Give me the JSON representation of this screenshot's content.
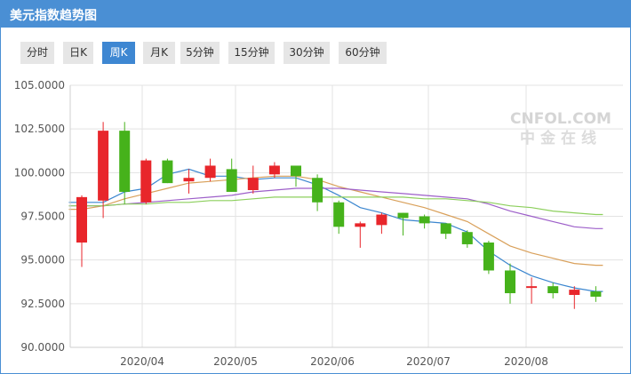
{
  "header": {
    "title": "美元指数趋势图"
  },
  "tabs": [
    {
      "label": "分时",
      "active": false
    },
    {
      "label": "日K",
      "active": false
    },
    {
      "label": "周K",
      "active": true
    },
    {
      "label": "月K",
      "active": false
    },
    {
      "label": "5分钟",
      "active": false
    },
    {
      "label": "15分钟",
      "active": false
    },
    {
      "label": "30分钟",
      "active": false
    },
    {
      "label": "60分钟",
      "active": false
    }
  ],
  "watermark": {
    "brand": "CNFOL.COM",
    "cn": "中金在线"
  },
  "colors": {
    "accent": "#4a8fd4",
    "active_tab": "#3e87d2",
    "up": "#e8262b",
    "down": "#46b21b",
    "ma5": "#3b86cf",
    "ma10": "#d9a05a",
    "ma20": "#9d5fc9",
    "ma30": "#8ccf5c"
  },
  "chart_data": {
    "type": "candlestick",
    "title": "",
    "xlabel": "",
    "ylabel": "",
    "ylim": [
      90,
      105
    ],
    "yticks": [
      "105.0000",
      "102.5000",
      "100.0000",
      "97.5000",
      "95.0000",
      "92.5000",
      "90.0000"
    ],
    "xticks": [
      "2020/04",
      "2020/05",
      "2020/06",
      "2020/07",
      "2020/08"
    ],
    "grid": true,
    "candles": [
      {
        "open": 96.0,
        "close": 98.6,
        "high": 98.7,
        "low": 94.6
      },
      {
        "open": 98.4,
        "close": 102.4,
        "high": 102.9,
        "low": 97.4
      },
      {
        "open": 102.4,
        "close": 98.9,
        "high": 102.9,
        "low": 98.2
      },
      {
        "open": 98.3,
        "close": 100.7,
        "high": 100.8,
        "low": 98.2
      },
      {
        "open": 100.7,
        "close": 99.4,
        "high": 100.8,
        "low": 99.4
      },
      {
        "open": 99.5,
        "close": 99.7,
        "high": 100.2,
        "low": 98.8
      },
      {
        "open": 99.7,
        "close": 100.4,
        "high": 100.8,
        "low": 99.5
      },
      {
        "open": 100.2,
        "close": 98.9,
        "high": 100.8,
        "low": 98.9
      },
      {
        "open": 99.0,
        "close": 99.7,
        "high": 100.4,
        "low": 98.8
      },
      {
        "open": 99.9,
        "close": 100.4,
        "high": 100.6,
        "low": 99.7
      },
      {
        "open": 100.4,
        "close": 99.8,
        "high": 100.4,
        "low": 99.2
      },
      {
        "open": 99.7,
        "close": 98.3,
        "high": 99.9,
        "low": 97.8
      },
      {
        "open": 98.3,
        "close": 96.9,
        "high": 98.4,
        "low": 96.5
      },
      {
        "open": 96.9,
        "close": 97.1,
        "high": 97.2,
        "low": 95.7
      },
      {
        "open": 97.0,
        "close": 97.6,
        "high": 97.7,
        "low": 96.5
      },
      {
        "open": 97.7,
        "close": 97.4,
        "high": 97.7,
        "low": 96.4
      },
      {
        "open": 97.5,
        "close": 97.1,
        "high": 97.6,
        "low": 96.8
      },
      {
        "open": 97.1,
        "close": 96.5,
        "high": 97.1,
        "low": 96.2
      },
      {
        "open": 96.6,
        "close": 95.9,
        "high": 96.7,
        "low": 95.7
      },
      {
        "open": 96.0,
        "close": 94.4,
        "high": 96.1,
        "low": 94.2
      },
      {
        "open": 94.4,
        "close": 93.1,
        "high": 94.8,
        "low": 92.5
      },
      {
        "open": 93.4,
        "close": 93.5,
        "high": 94.0,
        "low": 92.5
      },
      {
        "open": 93.5,
        "close": 93.1,
        "high": 93.7,
        "low": 92.8
      },
      {
        "open": 93.0,
        "close": 93.3,
        "high": 93.5,
        "low": 92.2
      },
      {
        "open": 93.2,
        "close": 92.9,
        "high": 93.5,
        "low": 92.6
      }
    ],
    "moving_averages": [
      {
        "values": [
          98.3,
          98.3,
          98.9,
          99.1,
          99.9,
          100.2,
          99.8,
          99.8,
          99.6,
          99.7,
          99.7,
          99.3,
          98.7,
          98.0,
          97.7,
          97.3,
          97.2,
          97.1,
          96.6,
          95.5,
          94.7,
          94.1,
          93.7,
          93.4,
          93.2
        ]
      },
      {
        "values": [
          97.9,
          98.1,
          98.5,
          98.8,
          99.1,
          99.4,
          99.5,
          99.6,
          99.7,
          99.8,
          99.8,
          99.6,
          99.2,
          98.9,
          98.6,
          98.3,
          98.0,
          97.6,
          97.2,
          96.5,
          95.8,
          95.4,
          95.1,
          94.8,
          94.7
        ]
      },
      {
        "values": [
          98.1,
          98.1,
          98.2,
          98.3,
          98.4,
          98.5,
          98.6,
          98.7,
          98.9,
          99.0,
          99.1,
          99.1,
          99.1,
          99.0,
          98.9,
          98.8,
          98.7,
          98.6,
          98.5,
          98.2,
          97.8,
          97.5,
          97.2,
          96.9,
          96.8
        ]
      },
      {
        "values": [
          98.1,
          98.1,
          98.2,
          98.2,
          98.3,
          98.3,
          98.4,
          98.4,
          98.5,
          98.6,
          98.6,
          98.6,
          98.6,
          98.6,
          98.6,
          98.6,
          98.5,
          98.5,
          98.4,
          98.3,
          98.1,
          98.0,
          97.8,
          97.7,
          97.6
        ]
      }
    ]
  }
}
